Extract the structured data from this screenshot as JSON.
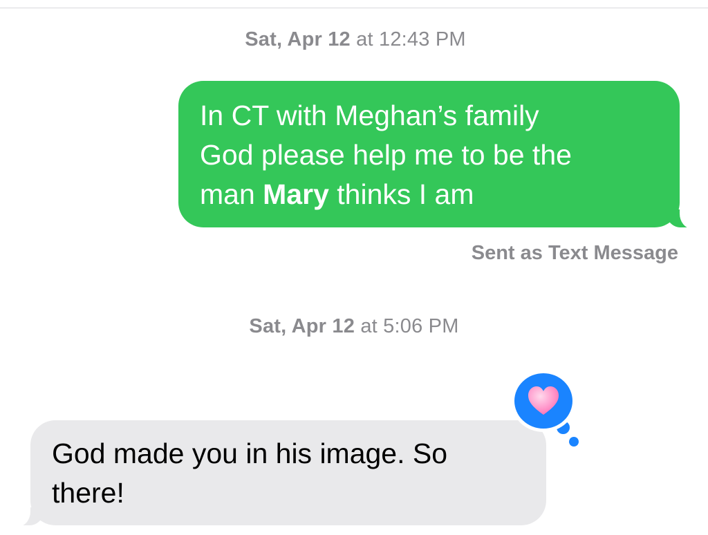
{
  "conversation": {
    "groups": [
      {
        "timestamp": {
          "day": "Sat, Apr 12",
          "time": "at 12:43 PM"
        }
      },
      {
        "timestamp": {
          "day": "Sat, Apr 12",
          "time": "at 5:06 PM"
        }
      }
    ],
    "sent_message": {
      "line1": "In CT with Meghan’s family",
      "line2": "God please help me to be the",
      "line3_before": "man ",
      "line3_mention": "Mary",
      "line3_after": " thinks I am",
      "status": "Sent as Text Message"
    },
    "received_message": {
      "text": "God made you in his image. So there!",
      "tapback": {
        "icon": "heart-icon",
        "color": "#1a84ff"
      }
    }
  },
  "colors": {
    "sent_bubble": "#34c759",
    "received_bubble": "#e9e9eb",
    "secondary_text": "#8a8a8e"
  }
}
